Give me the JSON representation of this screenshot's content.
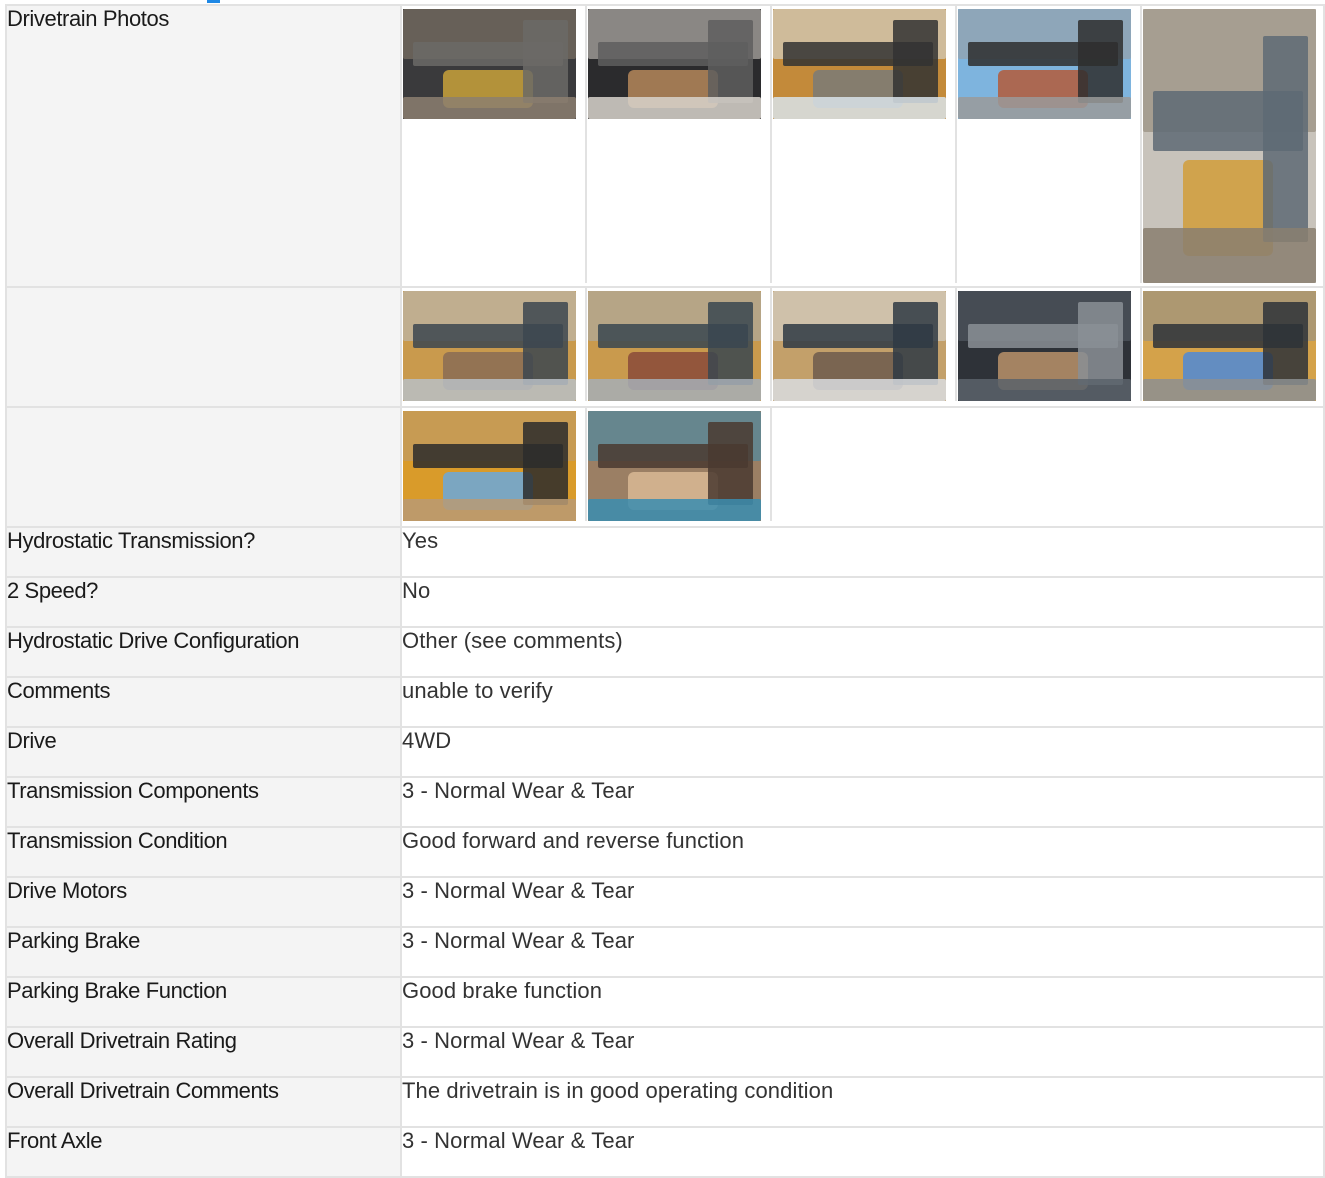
{
  "section": {
    "label": "Drivetrain Photos"
  },
  "photo_rows": [
    {
      "photos": [
        {
          "name": "drivetrain-photo-1",
          "palette": [
            "#3a3a3c",
            "#6b6a66",
            "#c9a23a",
            "#8c7f70"
          ]
        },
        {
          "name": "drivetrain-photo-2",
          "palette": [
            "#2b2b2d",
            "#5e5e5e",
            "#b5875a",
            "#d8d4cc"
          ]
        },
        {
          "name": "drivetrain-photo-3",
          "palette": [
            "#c38a3a",
            "#333",
            "#7a7a78",
            "#d9e3ea"
          ]
        },
        {
          "name": "drivetrain-photo-4",
          "palette": [
            "#7eb4de",
            "#2e2e2e",
            "#b35a3a",
            "#9a9a9a"
          ]
        },
        {
          "name": "drivetrain-photo-5",
          "palette": [
            "#c8c3bb",
            "#5e6a74",
            "#d19e3a",
            "#8a7f70"
          ],
          "tall": true
        }
      ]
    },
    {
      "photos": [
        {
          "name": "drivetrain-photo-6",
          "palette": [
            "#c99a4d",
            "#3c4650",
            "#8a6c55",
            "#b8bfc6"
          ]
        },
        {
          "name": "drivetrain-photo-7",
          "palette": [
            "#c99a4d",
            "#3a4650",
            "#8a4a3a",
            "#a6aeb6"
          ]
        },
        {
          "name": "drivetrain-photo-8",
          "palette": [
            "#c3a06a",
            "#2f3a44",
            "#6d5a4c",
            "#d9dcdf"
          ]
        },
        {
          "name": "drivetrain-photo-9",
          "palette": [
            "#2e3238",
            "#8a8f95",
            "#b9926a",
            "#5b636b"
          ]
        },
        {
          "name": "drivetrain-photo-10",
          "palette": [
            "#d4a24a",
            "#2e3238",
            "#4f8ad6",
            "#8c8f92"
          ]
        }
      ]
    },
    {
      "photos": [
        {
          "name": "drivetrain-photo-11",
          "palette": [
            "#d99b2a",
            "#2c2c2c",
            "#6aa8dc",
            "#b89a74"
          ]
        },
        {
          "name": "drivetrain-photo-12",
          "palette": [
            "#9b7f64",
            "#4a3a30",
            "#d9b894",
            "#3a8db0"
          ]
        }
      ]
    }
  ],
  "rows": [
    {
      "label": "Hydrostatic Transmission?",
      "value": "Yes"
    },
    {
      "label": "2 Speed?",
      "value": "No"
    },
    {
      "label": "Hydrostatic Drive Configuration",
      "value": "Other (see comments)"
    },
    {
      "label": "Comments",
      "value": "unable to verify"
    },
    {
      "label": "Drive",
      "value": "4WD"
    },
    {
      "label": "Transmission Components",
      "value": "3 - Normal Wear & Tear"
    },
    {
      "label": "Transmission Condition",
      "value": "Good forward and reverse function"
    },
    {
      "label": "Drive Motors",
      "value": "3 - Normal Wear & Tear"
    },
    {
      "label": "Parking Brake",
      "value": "3 - Normal Wear & Tear"
    },
    {
      "label": "Parking Brake Function",
      "value": "Good brake function"
    },
    {
      "label": "Overall Drivetrain Rating",
      "value": "3 - Normal Wear & Tear"
    },
    {
      "label": "Overall Drivetrain Comments",
      "value": "The drivetrain is in good operating condition"
    },
    {
      "label": "Front Axle",
      "value": "3 - Normal Wear & Tear"
    }
  ]
}
